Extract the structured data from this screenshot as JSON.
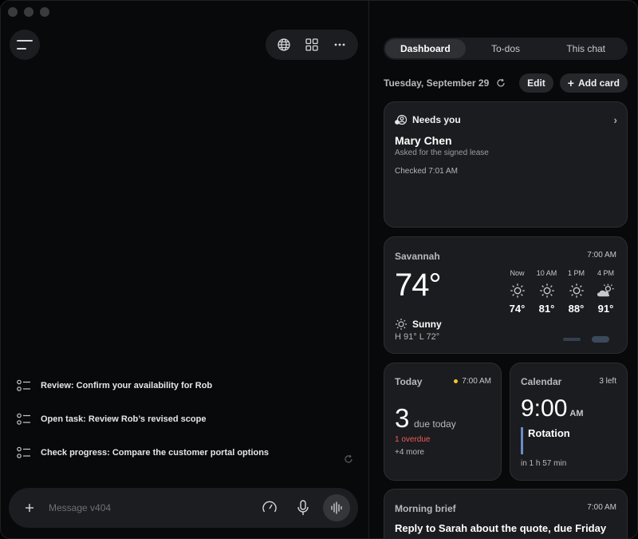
{
  "left": {
    "toolbar": {
      "menu_icon": "hamburger-icon",
      "globe_icon": "globe-icon",
      "grid_icon": "grid-icon",
      "more_icon": "ellipsis-icon"
    },
    "suggestions": [
      {
        "label": "Review: Confirm your availability for Rob"
      },
      {
        "label": "Open task: Review Rob’s revised scope"
      },
      {
        "label": "Check progress: Compare the customer portal options"
      }
    ],
    "composer": {
      "placeholder": "Message v404",
      "value": ""
    }
  },
  "right": {
    "tabs": [
      {
        "label": "Dashboard",
        "active": true
      },
      {
        "label": "To-dos",
        "active": false
      },
      {
        "label": "This chat",
        "active": false
      }
    ],
    "date": "Tuesday, September 29",
    "edit_label": "Edit",
    "add_card_label": "Add card",
    "needs": {
      "header": "Needs you",
      "name": "Mary Chen",
      "subtitle": "Asked for the signed lease",
      "checked": "Checked 7:01 AM"
    },
    "weather": {
      "city": "Savannah",
      "time": "7:00 AM",
      "temp": "74°",
      "condition": "Sunny",
      "high_low": "H 91°  L 72°",
      "hourly": [
        {
          "label": "Now",
          "temp": "74°",
          "icon": "sun-icon"
        },
        {
          "label": "10 AM",
          "temp": "81°",
          "icon": "sun-icon"
        },
        {
          "label": "1 PM",
          "temp": "88°",
          "icon": "sun-icon"
        },
        {
          "label": "4 PM",
          "temp": "91°",
          "icon": "partly-cloudy-icon"
        }
      ]
    },
    "today": {
      "title": "Today",
      "time": "7:00 AM",
      "count": "3",
      "due_label": "due today",
      "overdue": "1 overdue",
      "more": "+4 more"
    },
    "calendar": {
      "title": "Calendar",
      "left": "3 left",
      "time": "9:00",
      "ampm": "AM",
      "event": "Rotation",
      "in": "in 1 h 57 min"
    },
    "brief": {
      "title": "Morning brief",
      "time": "7:00 AM",
      "text": "Reply to Sarah about the quote, due Friday"
    }
  },
  "colors": {
    "background": "#08090b",
    "card": "#1b1c1f",
    "overdue": "#ef5a57",
    "today_dot": "#f4c430",
    "calendar_bar": "#6b8cc7"
  }
}
